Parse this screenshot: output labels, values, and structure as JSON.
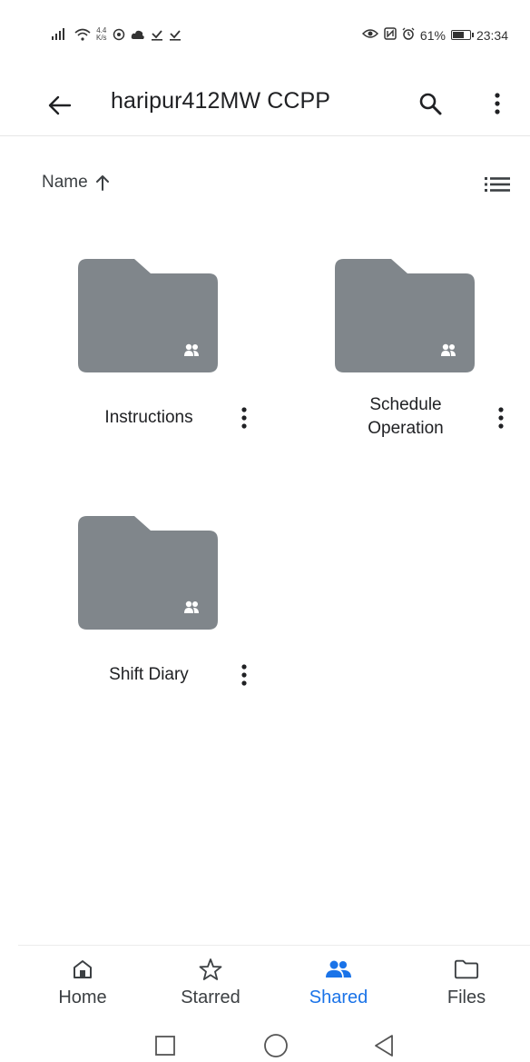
{
  "status_bar": {
    "speed_value": "4.4",
    "speed_unit": "K/s",
    "battery_text": "61%",
    "battery_level": 0.61,
    "time": "23:34"
  },
  "app_bar": {
    "title": "haripur412MW CCPP"
  },
  "sort": {
    "label": "Name",
    "direction": "ascending"
  },
  "folders": [
    {
      "name_lines": [
        "Instructions"
      ],
      "shared": true
    },
    {
      "name_lines": [
        "Schedule",
        "Operation"
      ],
      "shared": true
    },
    {
      "name_lines": [
        "Shift Diary"
      ],
      "shared": true
    }
  ],
  "bottom_nav": {
    "items": [
      {
        "label": "Home",
        "icon": "home-icon",
        "active": false
      },
      {
        "label": "Starred",
        "icon": "star-icon",
        "active": false
      },
      {
        "label": "Shared",
        "icon": "shared-people-icon",
        "active": true
      },
      {
        "label": "Files",
        "icon": "folder-icon",
        "active": false
      }
    ]
  },
  "colors": {
    "folder": "#80868b",
    "accent": "#1a73e8",
    "text": "#202124"
  }
}
